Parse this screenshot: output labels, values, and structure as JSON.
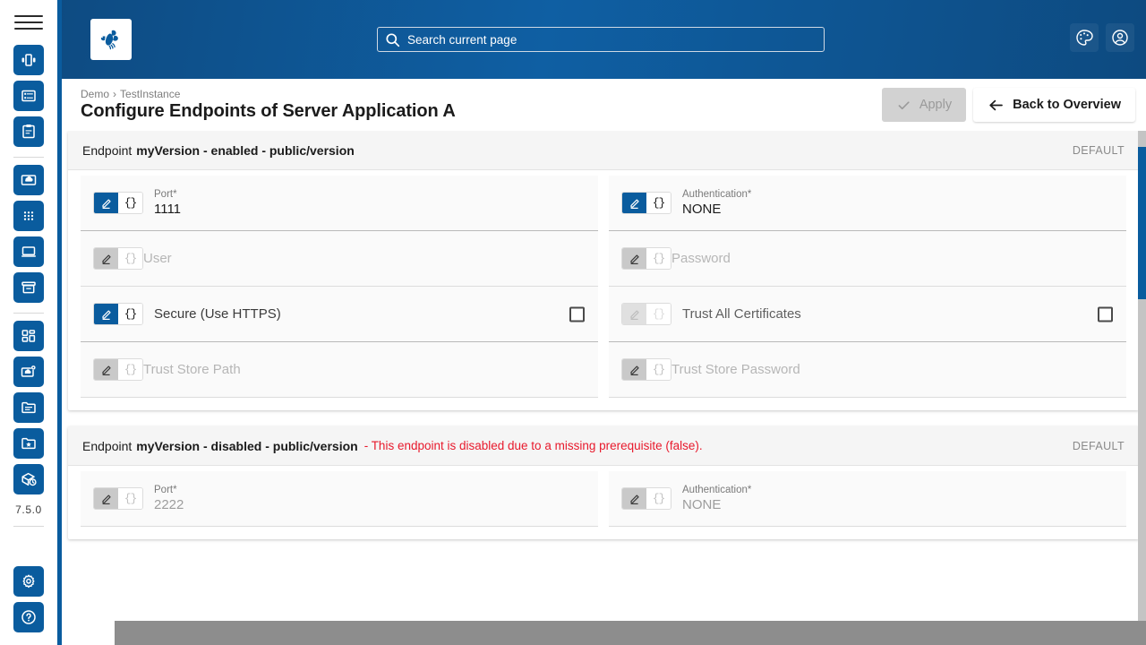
{
  "sidebar": {
    "menu_icon": "hamburger-icon",
    "groups": [
      [
        {
          "name": "dashboard-icon",
          "glyph": "dashboard"
        },
        {
          "name": "server-list-icon",
          "glyph": "list"
        },
        {
          "name": "clipboard-icon",
          "glyph": "clipboard"
        }
      ],
      [
        {
          "name": "cloud-icon",
          "glyph": "cloud"
        },
        {
          "name": "apps-grid-icon",
          "glyph": "grid"
        },
        {
          "name": "monitor-icon",
          "glyph": "monitor"
        },
        {
          "name": "archive-icon",
          "glyph": "archive"
        }
      ],
      [
        {
          "name": "modules-icon",
          "glyph": "modules"
        },
        {
          "name": "cloud-settings-icon",
          "glyph": "cloudcog"
        },
        {
          "name": "folder-lines-icon",
          "glyph": "folderlines"
        },
        {
          "name": "folder-star-icon",
          "glyph": "folderstar"
        },
        {
          "name": "package-clock-icon",
          "glyph": "packageclock"
        }
      ]
    ],
    "version": "7.5.0",
    "bottom": [
      {
        "name": "settings-gear-icon",
        "glyph": "gear"
      },
      {
        "name": "help-icon",
        "glyph": "help"
      }
    ]
  },
  "topbar": {
    "logo": "bee-logo",
    "search": {
      "placeholder": "Search current page",
      "value": "",
      "icon": "search-icon"
    },
    "theme_icon": "palette-icon",
    "account_icon": "user-account-icon"
  },
  "header": {
    "breadcrumb": [
      "Demo",
      "TestInstance"
    ],
    "breadcrumb_separator": "›",
    "title": "Configure Endpoints of Server Application A",
    "apply_label": "Apply",
    "apply_icon": "check-icon",
    "apply_disabled": true,
    "back_label": "Back to Overview",
    "back_icon": "arrow-left-icon"
  },
  "colors": {
    "brand_blue": "#0a5c9e",
    "header_gradient_from": "#0e4b82",
    "header_gradient_to": "#0d4a80",
    "error_red": "#e8192c",
    "disabled_grey": "#d2d2d2"
  },
  "endpoints": [
    {
      "prefix": "Endpoint",
      "name": "myVersion - enabled - public/version",
      "warning": "",
      "badge": "DEFAULT",
      "disabled": false,
      "rows": [
        [
          {
            "name": "port-field",
            "label": "Port*",
            "value": "1111",
            "placeholder": "",
            "type": "text",
            "disabled": false,
            "mode": "edit",
            "strong_underline": true
          },
          {
            "name": "authentication-field",
            "label": "Authentication*",
            "value": "NONE",
            "placeholder": "",
            "type": "select",
            "disabled": false,
            "mode": "edit",
            "strong_underline": true
          }
        ],
        [
          {
            "name": "user-field",
            "label": "",
            "value": "",
            "placeholder": "User",
            "type": "text",
            "disabled": true,
            "mode": "edit",
            "strong_underline": false
          },
          {
            "name": "password-field",
            "label": "",
            "value": "",
            "placeholder": "Password",
            "type": "password",
            "disabled": true,
            "mode": "edit",
            "strong_underline": false
          }
        ],
        [
          {
            "name": "secure-https-checkbox",
            "label": "Secure (Use HTTPS)",
            "value": "",
            "placeholder": "",
            "type": "checkbox",
            "checked": false,
            "disabled": false,
            "mode": "edit",
            "strong_underline": true
          },
          {
            "name": "trust-all-certificates-checkbox",
            "label": "Trust All Certificates",
            "value": "",
            "placeholder": "",
            "type": "checkbox",
            "checked": false,
            "disabled": true,
            "mode": "edit",
            "strong_underline": true
          }
        ],
        [
          {
            "name": "trust-store-path-field",
            "label": "",
            "value": "",
            "placeholder": "Trust Store Path",
            "type": "text",
            "disabled": true,
            "mode": "edit",
            "strong_underline": false
          },
          {
            "name": "trust-store-password-field",
            "label": "",
            "value": "",
            "placeholder": "Trust Store Password",
            "type": "password",
            "disabled": true,
            "mode": "edit",
            "strong_underline": false
          }
        ]
      ]
    },
    {
      "prefix": "Endpoint",
      "name": "myVersion - disabled - public/version",
      "warning": "- This endpoint is disabled due to a missing prerequisite (false).",
      "badge": "DEFAULT",
      "disabled": true,
      "rows": [
        [
          {
            "name": "port-field",
            "label": "Port*",
            "value": "2222",
            "placeholder": "",
            "type": "text",
            "disabled": true,
            "mode": "edit",
            "strong_underline": false
          },
          {
            "name": "authentication-field",
            "label": "Authentication*",
            "value": "NONE",
            "placeholder": "",
            "type": "select",
            "disabled": true,
            "mode": "edit",
            "strong_underline": false
          }
        ]
      ]
    }
  ],
  "toggle": {
    "edit_icon": "pencil-icon",
    "expression_icon": "braces-icon",
    "expression_glyph": "{}"
  },
  "scrollbars": {
    "vertical_thumb_color": "#0a5c9e",
    "vertical_track_color": "#c4c4c4",
    "horizontal_color": "#8d8d8d"
  }
}
